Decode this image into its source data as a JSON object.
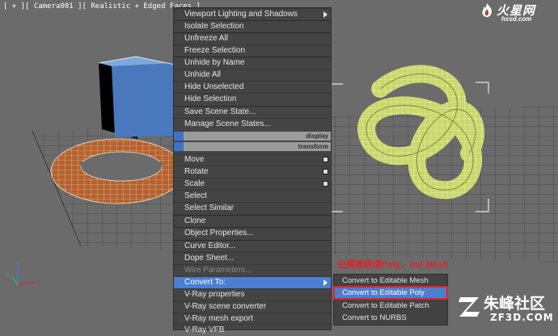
{
  "viewport": {
    "label": "[ + ][ Camera001 ][ Realistic + Edged Faces ]"
  },
  "logo_top": {
    "brand": "火星网",
    "url": "hxsd.com"
  },
  "logo_bottom": {
    "brand": "朱峰社区",
    "site": "ZF3D.COM"
  },
  "annotation": "记得是转成Poly，not Mesh",
  "quad_menu": {
    "items": [
      {
        "label": "Viewport Lighting and Shadows",
        "submenu": true
      },
      {
        "label": "Isolate Selection"
      },
      {
        "label": "Unfreeze All"
      },
      {
        "label": "Freeze Selection"
      },
      {
        "label": "Unhide by Name"
      },
      {
        "label": "Unhide All"
      },
      {
        "label": "Hide Unselected"
      },
      {
        "label": "Hide Selection"
      },
      {
        "label": "Save Scene State..."
      },
      {
        "label": "Manage Scene States..."
      }
    ],
    "headers": [
      "display",
      "transform"
    ],
    "transform_items": [
      {
        "label": "Move",
        "options": true
      },
      {
        "label": "Rotate",
        "options": true
      },
      {
        "label": "Scale",
        "options": true
      },
      {
        "label": "Select"
      },
      {
        "label": "Select Similar"
      },
      {
        "label": "Clone"
      },
      {
        "label": "Object Properties..."
      },
      {
        "label": "Curve Editor..."
      },
      {
        "label": "Dope Sheet..."
      },
      {
        "label": "Wire Parameters...",
        "disabled": true
      },
      {
        "label": "Convert To:",
        "submenu": true,
        "highlighted": true
      },
      {
        "label": "V-Ray properties"
      },
      {
        "label": "V-Ray scene converter"
      },
      {
        "label": "V-Ray mesh export"
      },
      {
        "label": "V-Ray VFB"
      }
    ]
  },
  "convert_submenu": {
    "items": [
      {
        "label": "Convert to Editable Mesh"
      },
      {
        "label": "Convert to Editable Poly",
        "highlighted": true
      },
      {
        "label": "Convert to Editable Patch"
      },
      {
        "label": "Convert to NURBS"
      }
    ]
  },
  "colors": {
    "menu_bg": "#444444",
    "highlight": "#4a7fd1",
    "annotation": "#e8202a",
    "viewport_bg": "#6b6b6b",
    "box": "#4a78bc",
    "torus": "#b5622e",
    "knot": "#c9d86a"
  }
}
